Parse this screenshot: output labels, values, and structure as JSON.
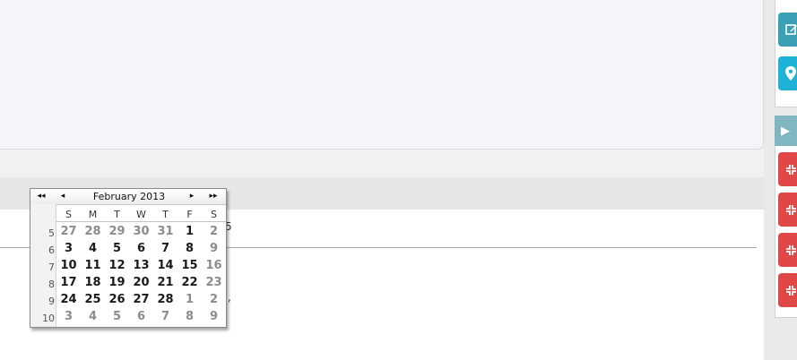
{
  "calendar": {
    "title": "February 2013",
    "nav": {
      "prev_year": "◂◂",
      "prev_month": "◂",
      "next_month": "▸",
      "next_year": "▸▸"
    },
    "weekday_headers": [
      "S",
      "M",
      "T",
      "W",
      "T",
      "F",
      "S"
    ],
    "weeks": [
      {
        "number": "5",
        "days": [
          {
            "d": "27",
            "out": true
          },
          {
            "d": "28",
            "out": true
          },
          {
            "d": "29",
            "out": true
          },
          {
            "d": "30",
            "out": true
          },
          {
            "d": "31",
            "out": true
          },
          {
            "d": "1",
            "out": false
          },
          {
            "d": "2",
            "out": true
          }
        ]
      },
      {
        "number": "6",
        "days": [
          {
            "d": "3",
            "out": false
          },
          {
            "d": "4",
            "out": false
          },
          {
            "d": "5",
            "out": false
          },
          {
            "d": "6",
            "out": false
          },
          {
            "d": "7",
            "out": false
          },
          {
            "d": "8",
            "out": false
          },
          {
            "d": "9",
            "out": true
          }
        ]
      },
      {
        "number": "7",
        "days": [
          {
            "d": "10",
            "out": false
          },
          {
            "d": "11",
            "out": false
          },
          {
            "d": "12",
            "out": false
          },
          {
            "d": "13",
            "out": false
          },
          {
            "d": "14",
            "out": false
          },
          {
            "d": "15",
            "out": false
          },
          {
            "d": "16",
            "out": true
          }
        ]
      },
      {
        "number": "8",
        "days": [
          {
            "d": "17",
            "out": false
          },
          {
            "d": "18",
            "out": false
          },
          {
            "d": "19",
            "out": false
          },
          {
            "d": "20",
            "out": false
          },
          {
            "d": "21",
            "out": false
          },
          {
            "d": "22",
            "out": false
          },
          {
            "d": "23",
            "out": true
          }
        ]
      },
      {
        "number": "9",
        "days": [
          {
            "d": "24",
            "out": false
          },
          {
            "d": "25",
            "out": false
          },
          {
            "d": "26",
            "out": false
          },
          {
            "d": "27",
            "out": false
          },
          {
            "d": "28",
            "out": false
          },
          {
            "d": "1",
            "out": true
          },
          {
            "d": "2",
            "out": true
          }
        ]
      },
      {
        "number": "10",
        "days": [
          {
            "d": "3",
            "out": true
          },
          {
            "d": "4",
            "out": true
          },
          {
            "d": "5",
            "out": true
          },
          {
            "d": "6",
            "out": true
          },
          {
            "d": "7",
            "out": true
          },
          {
            "d": "8",
            "out": true
          },
          {
            "d": "9",
            "out": true
          }
        ]
      }
    ]
  },
  "background": {
    "fragment_1": "5",
    "fragment_2": ","
  },
  "sidebar": {
    "buttons_top": [
      {
        "icon": "edit-icon",
        "color": "#3b9fb5"
      },
      {
        "icon": "map-marker-icon",
        "color": "#1eb3d6"
      }
    ],
    "panel_toggle": {
      "icon": "play-icon",
      "label": "▶",
      "color": "#7fb6c1"
    },
    "buttons_bottom": [
      {
        "icon": "collapse-icon",
        "color": "#e04848"
      },
      {
        "icon": "collapse-icon",
        "color": "#e04848"
      },
      {
        "icon": "collapse-icon",
        "color": "#e04848"
      },
      {
        "icon": "collapse-icon",
        "color": "#e04848"
      }
    ]
  }
}
